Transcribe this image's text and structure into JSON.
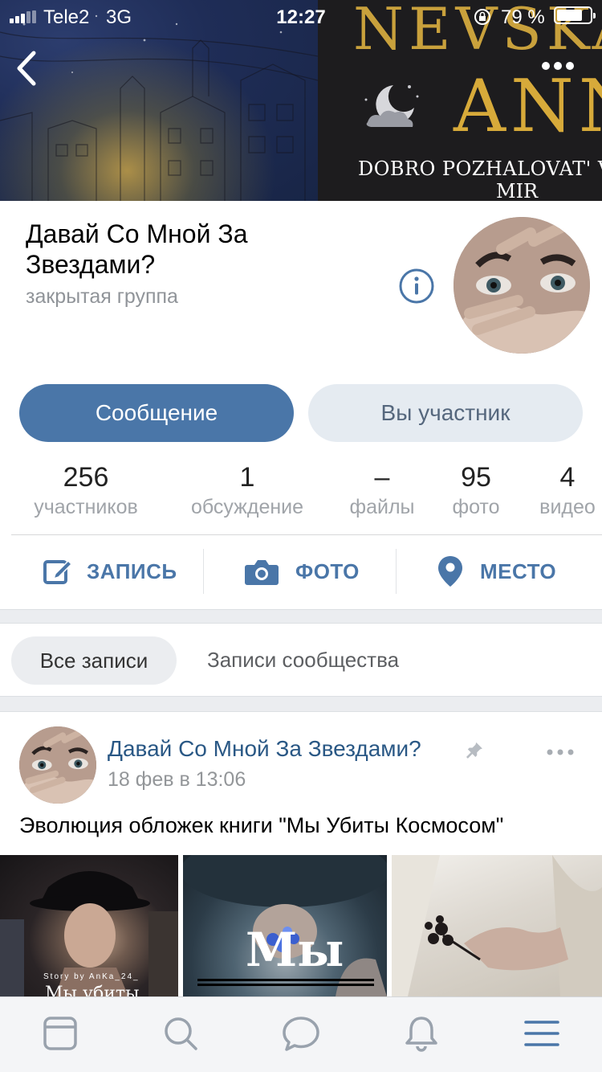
{
  "status_bar": {
    "carrier": "Tele2",
    "network": "3G",
    "time": "12:27",
    "battery_percent": "79 %",
    "battery_level": 0.79
  },
  "cover": {
    "title_line1": "NEVSKA",
    "title_line2": "ANN",
    "subtitle_line1": "DOBRO POZHALOVAT' V MOY ST",
    "subtitle_line2": "MIR"
  },
  "header": {
    "group_name": "Давай Со Мной За Звездами?",
    "group_type": "закрытая группа"
  },
  "buttons": {
    "message": "Сообщение",
    "member": "Вы участник"
  },
  "counters": [
    {
      "value": "256",
      "label": "участников"
    },
    {
      "value": "1",
      "label": "обсуждение"
    },
    {
      "value": "–",
      "label": "файлы"
    },
    {
      "value": "95",
      "label": "фото"
    },
    {
      "value": "4",
      "label": "видео"
    }
  ],
  "actions": {
    "post": "ЗАПИСЬ",
    "photo": "ФОТО",
    "place": "МЕСТО"
  },
  "filter_tabs": {
    "all": "Все записи",
    "community": "Записи сообщества"
  },
  "post": {
    "author": "Давай Со Мной За Звездами?",
    "date": "18 фев в 13:06",
    "text": "Эволюция обложек книги \"Мы Убиты Космосом\"",
    "photos": [
      {
        "overlay_small": "Story by AnKa_24_",
        "overlay_big": "Мы убиты"
      },
      {
        "overlay_big": "Мы"
      },
      {}
    ]
  },
  "tab_bar": {
    "items": [
      "news-icon",
      "search-icon",
      "messages-icon",
      "notifications-icon",
      "menu-icon"
    ]
  },
  "colors": {
    "accent": "#4a76a8",
    "link": "#2a5885",
    "secondary_button_bg": "#e5ebf1",
    "muted_text": "#909499"
  }
}
